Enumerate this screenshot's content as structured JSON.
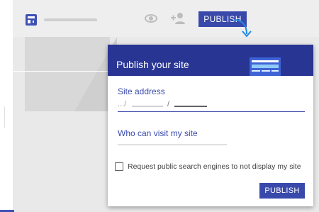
{
  "toolbar": {
    "publish_label": "PUBLISH"
  },
  "icons": {
    "logo": "layout-icon",
    "preview": "eye-icon",
    "share": "add-person-icon",
    "pointer": "curved-arrow-down-icon"
  },
  "dialog": {
    "title": "Publish your site",
    "site_address_label": "Site address",
    "site_address_prefix": ".../",
    "site_address_separator": "/",
    "visitors_label": "Who can visit my site",
    "checkbox_label": "Request public search engines to not display my site",
    "checkbox_checked": false,
    "publish_label": "PUBLISH"
  },
  "colors": {
    "accent": "#3949ab",
    "header": "#283593",
    "arrow": "#1e88e5"
  }
}
